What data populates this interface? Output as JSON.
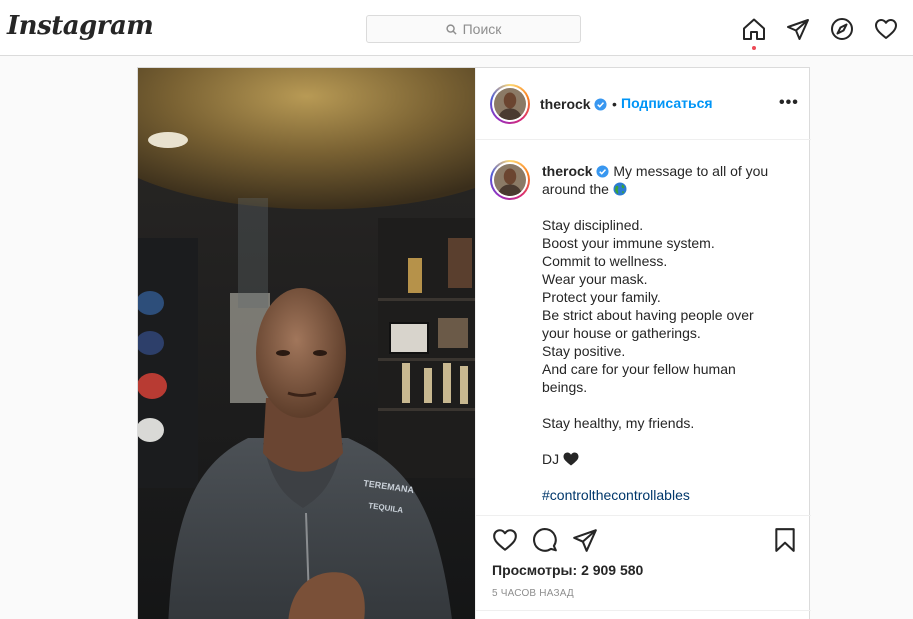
{
  "header": {
    "logo_text": "Instagram",
    "search_placeholder": "Поиск",
    "icons": [
      "home-icon",
      "direct-icon",
      "explore-icon",
      "activity-icon"
    ]
  },
  "post": {
    "username": "therock",
    "verified": true,
    "follow_label": "Подписаться",
    "separator": "•",
    "more_label": "•••",
    "caption": {
      "first_line": "My message to all of you",
      "second_line": "around the",
      "lines_group1": [
        "Stay disciplined.",
        "Boost your immune system.",
        "Commit to wellness.",
        "Wear your mask.",
        "Protect your family.",
        "Be strict about having people over",
        "your house or gatherings.",
        "Stay positive.",
        "And care for your fellow human",
        "beings."
      ],
      "line_healthy": "Stay healthy, my friends.",
      "signoff": "DJ",
      "hashtag": "#controlthecontrollables"
    },
    "views_label": "Просмотры:",
    "views_count": "2 909 580",
    "time": "5 часов назад",
    "shirt_text_top": "TEREMANA",
    "shirt_text_bottom": "TEQUILA"
  },
  "colors": {
    "accent_blue": "#0095f6",
    "hashtag": "#00376b",
    "notification_dot": "#ed4956",
    "border": "#dbdbdb"
  }
}
